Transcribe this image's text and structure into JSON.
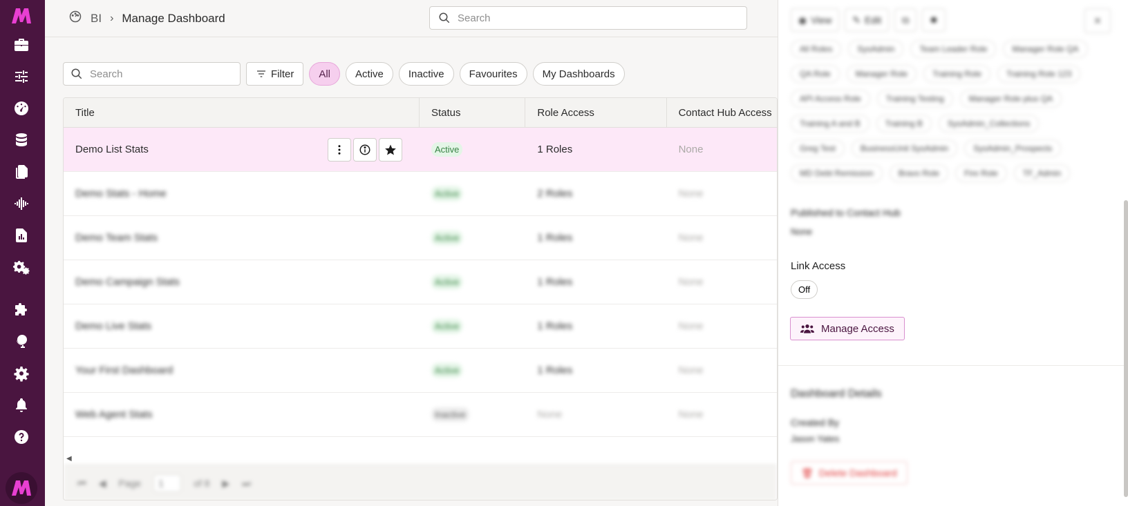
{
  "sidebar": {
    "logo_top": "mpower-logo",
    "items": [
      {
        "name": "toolbox-icon"
      },
      {
        "name": "sliders-icon"
      },
      {
        "name": "dashboard-gauge-icon"
      },
      {
        "name": "database-icon"
      },
      {
        "name": "files-icon"
      },
      {
        "name": "audio-wave-icon"
      },
      {
        "name": "report-chart-icon"
      },
      {
        "name": "gears-icon"
      },
      {
        "name": "puzzle-icon"
      },
      {
        "name": "globe-icon"
      },
      {
        "name": "settings-gear-icon"
      },
      {
        "name": "bell-icon"
      },
      {
        "name": "help-icon"
      }
    ],
    "logo_bottom": "mpower-logo"
  },
  "header": {
    "breadcrumb_root": "BI",
    "breadcrumb_sep": "›",
    "breadcrumb_current": "Manage Dashboard",
    "search_placeholder": "Search"
  },
  "toolbar": {
    "search_placeholder": "Search",
    "filter_label": "Filter",
    "pills": [
      "All",
      "Active",
      "Inactive",
      "Favourites",
      "My Dashboards"
    ],
    "active_pill": "All"
  },
  "table": {
    "columns": [
      "Title",
      "Status",
      "Role Access",
      "Contact Hub Access"
    ],
    "rows": [
      {
        "title": "Demo List Stats",
        "status": "Active",
        "roles": "1 Roles",
        "hub": "None"
      },
      {
        "title": "Demo Stats - Home",
        "status": "Active",
        "roles": "2 Roles",
        "hub": "None"
      },
      {
        "title": "Demo Team Stats",
        "status": "Active",
        "roles": "1 Roles",
        "hub": "None"
      },
      {
        "title": "Demo Campaign Stats",
        "status": "Active",
        "roles": "1 Roles",
        "hub": "None"
      },
      {
        "title": "Demo Live Stats",
        "status": "Active",
        "roles": "1 Roles",
        "hub": "None"
      },
      {
        "title": "Your First Dashboard",
        "status": "Active",
        "roles": "1 Roles",
        "hub": "None"
      },
      {
        "title": "Web Agent Stats",
        "status": "Inactive",
        "roles": "None",
        "hub": "None"
      }
    ],
    "footer": {
      "page_label": "Page",
      "page_value": "1",
      "of_label": "of 8"
    }
  },
  "panel": {
    "buttons": [
      "View",
      "Edit"
    ],
    "close": "×",
    "roles": [
      "All Roles",
      "SysAdmin",
      "Team Leader Role",
      "Manager Role QA",
      "QA Role",
      "Manager Role",
      "Training Role",
      "Training Role 123",
      "API Access Role",
      "Training Testing",
      "Manager Role plus QA",
      "Training A and B",
      "Training B",
      "SysAdmin_Collections",
      "Greg Test",
      "BusinessUnit SysAdmin",
      "SysAdmin_Prospects",
      "MD Debt Remission",
      "Bravo Role",
      "Fire Role",
      "TF_Admin"
    ],
    "published_label": "Published to Contact Hub",
    "published_value": "None",
    "link_access_label": "Link Access",
    "link_access_value": "Off",
    "manage_access_label": "Manage Access",
    "details_title": "Dashboard Details",
    "created_by_label": "Created By",
    "created_by_value": "Jason Yates",
    "delete_label": "Delete Dashboard"
  },
  "colors": {
    "sidebar_bg": "#4a1540",
    "accent_pink": "#f6cdee",
    "selected_row": "#fde7f8",
    "logo": "#e83fd2"
  }
}
